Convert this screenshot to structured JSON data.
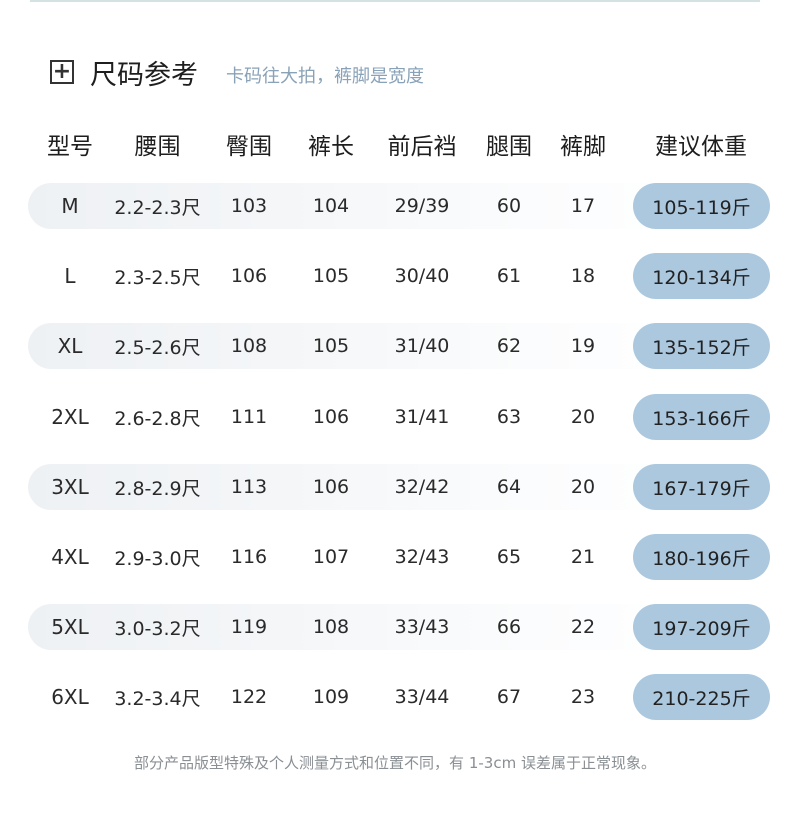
{
  "header": {
    "title": "尺码参考",
    "subtitle": "卡码往大拍，裤脚是宽度",
    "expand_icon": "plus-square-icon"
  },
  "table": {
    "columns": [
      "型号",
      "腰围",
      "臀围",
      "裤长",
      "前后裆",
      "腿围",
      "裤脚",
      "建议体重"
    ],
    "rows": [
      {
        "size": "M",
        "waist": "2.2-2.3尺",
        "hip": "103",
        "length": "104",
        "rise": "29/39",
        "thigh": "60",
        "hem": "17",
        "weight": "105-119斤"
      },
      {
        "size": "L",
        "waist": "2.3-2.5尺",
        "hip": "106",
        "length": "105",
        "rise": "30/40",
        "thigh": "61",
        "hem": "18",
        "weight": "120-134斤"
      },
      {
        "size": "XL",
        "waist": "2.5-2.6尺",
        "hip": "108",
        "length": "105",
        "rise": "31/40",
        "thigh": "62",
        "hem": "19",
        "weight": "135-152斤"
      },
      {
        "size": "2XL",
        "waist": "2.6-2.8尺",
        "hip": "111",
        "length": "106",
        "rise": "31/41",
        "thigh": "63",
        "hem": "20",
        "weight": "153-166斤"
      },
      {
        "size": "3XL",
        "waist": "2.8-2.9尺",
        "hip": "113",
        "length": "106",
        "rise": "32/42",
        "thigh": "64",
        "hem": "20",
        "weight": "167-179斤"
      },
      {
        "size": "4XL",
        "waist": "2.9-3.0尺",
        "hip": "116",
        "length": "107",
        "rise": "32/43",
        "thigh": "65",
        "hem": "21",
        "weight": "180-196斤"
      },
      {
        "size": "5XL",
        "waist": "3.0-3.2尺",
        "hip": "119",
        "length": "108",
        "rise": "33/43",
        "thigh": "66",
        "hem": "22",
        "weight": "197-209斤"
      },
      {
        "size": "6XL",
        "waist": "3.2-3.4尺",
        "hip": "122",
        "length": "109",
        "rise": "33/44",
        "thigh": "67",
        "hem": "23",
        "weight": "210-225斤"
      }
    ]
  },
  "footnote": "部分产品版型特殊及个人测量方式和位置不同，有 1-3cm 误差属于正常现象。",
  "colors": {
    "accent_pill": "#abc8df",
    "subtitle": "#8aa2b8",
    "striped_row": "#f1f4f6"
  }
}
